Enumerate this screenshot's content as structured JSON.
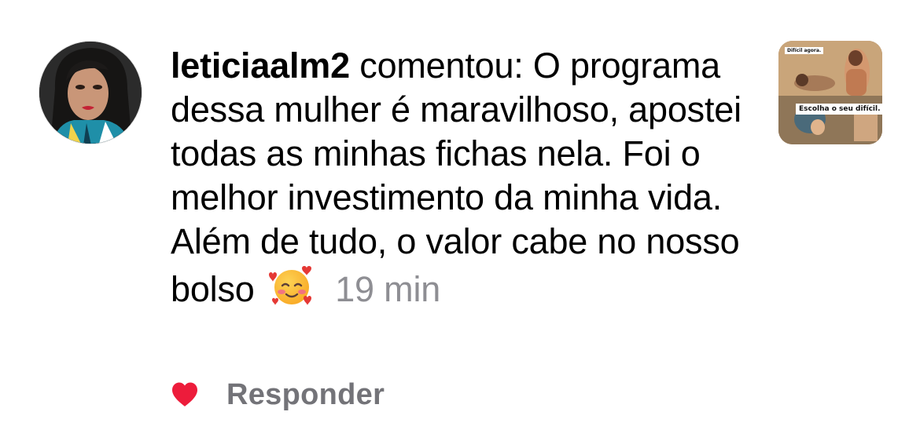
{
  "comment": {
    "username": "leticiaalm2",
    "text": "comentou: O programa dessa mulher é maravilhoso, apostei todas as minhas fichas nela. Foi o melhor investimento da minha vida. Além de tudo, o valor cabe no nosso bolso",
    "emoji": "smiling-face-with-hearts",
    "timestamp": "19 min"
  },
  "actions": {
    "like_icon": "heart-filled-icon",
    "like_color": "#ed1c3b",
    "reply_label": "Responder"
  },
  "post_thumbnail": {
    "corner_text": "Difícil agora.",
    "caption": "Escolha o seu difícil."
  },
  "colors": {
    "text": "#000000",
    "muted": "#8e8e93",
    "reply": "#737378"
  }
}
